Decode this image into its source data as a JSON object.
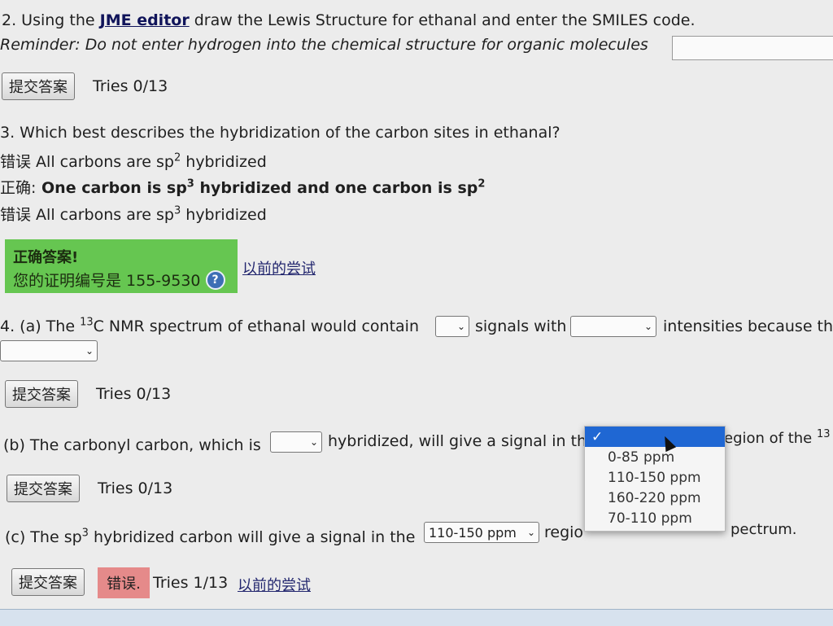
{
  "q2": {
    "prefix": "2. Using the ",
    "link": "JME editor",
    "suffix": " draw the Lewis Structure for ethanal and enter the SMILES code.",
    "reminder": "Reminder: Do not enter hydrogen into the chemical structure for organic molecules",
    "submit": "提交答案",
    "tries": "Tries 0/13"
  },
  "q3": {
    "question": "3. Which best describes the hybridization of the carbon sites in ethanal?",
    "options": [
      {
        "tag": "错误",
        "a": " All carbons are sp",
        "sup": "2",
        "b": " hybridized"
      },
      {
        "tag": "正确:",
        "a": " One carbon is sp",
        "sup": "3",
        "b": " hybridized and one carbon is sp",
        "sup2": "2"
      },
      {
        "tag": "错误",
        "a": " All carbons are sp",
        "sup": "3",
        "b": " hybridized"
      }
    ],
    "correct_title": "正确答案!",
    "cert_text": "您的证明编号是 155-9530",
    "previous_link": "以前的尝试"
  },
  "q4a": {
    "t1": "4. (a) The ",
    "sup": "13",
    "t2": "C NMR spectrum of ethanal would contain",
    "t3": "signals with",
    "t4": "intensities because the",
    "submit": "提交答案",
    "tries": "Tries 0/13"
  },
  "q4b": {
    "t1": "(b) The carbonyl carbon, which is",
    "t2": "hybridized, will give a signal in th",
    "t3": "egion of the ",
    "sup": "13",
    "submit": "提交答案",
    "tries": "Tries 0/13",
    "dropdown": {
      "check": "✓",
      "options": [
        "0-85 ppm",
        "110-150 ppm",
        "160-220 ppm",
        "70-110 ppm"
      ]
    }
  },
  "q4c": {
    "t1": "(c) The sp",
    "sup": "3",
    "t2": " hybridized carbon will give a signal in the",
    "selected": "110-150 ppm",
    "t3": "regio",
    "t4": "pectrum.",
    "submit": "提交答案",
    "error": "错误.",
    "tries": "Tries 1/13",
    "previous_link": "以前的尝试"
  },
  "colors": {
    "correct_box": "#66c651",
    "error_badge": "#e58a8a",
    "dropdown_highlight": "#1f67d3"
  }
}
